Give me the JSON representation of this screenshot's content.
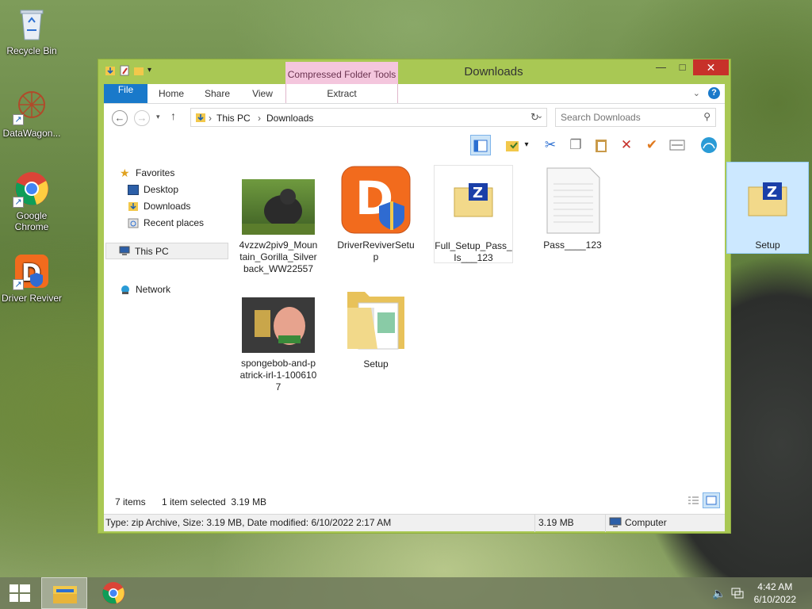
{
  "desktop": {
    "icons": [
      {
        "label": "Recycle Bin"
      },
      {
        "label": "DataWagon..."
      },
      {
        "label": "Google Chrome"
      },
      {
        "label": "Driver Reviver"
      }
    ]
  },
  "window": {
    "title": "Downloads",
    "context_tab_group": "Compressed Folder Tools",
    "ribbon_tabs": [
      "File",
      "Home",
      "Share",
      "View",
      "Extract"
    ],
    "address": {
      "crumbs": [
        "This PC",
        "Downloads"
      ]
    },
    "search": {
      "placeholder": "Search Downloads"
    },
    "nav": {
      "favorites": "Favorites",
      "desktop": "Desktop",
      "downloads": "Downloads",
      "recent": "Recent places",
      "this_pc": "This PC",
      "network": "Network"
    },
    "files": [
      {
        "name": "4vzzw2piv9_Mountain_Gorilla_Silverback_WW22557",
        "type": "image"
      },
      {
        "name": "DriverReviverSetup",
        "type": "app"
      },
      {
        "name": "Full_Setup_Pass_Is___123",
        "type": "zip"
      },
      {
        "name": "Pass____123",
        "type": "text"
      },
      {
        "name": "Setup",
        "type": "zip",
        "selected": true
      },
      {
        "name": "spongebob-and-patrick-irl-1-1006107",
        "type": "image"
      },
      {
        "name": "Setup",
        "type": "folder"
      }
    ],
    "status": {
      "items_count": "7 items",
      "selected": "1 item selected  3.19 MB",
      "details": "Type: zip Archive, Size: 3.19 MB, Date modified: 6/10/2022 2:17 AM",
      "size": "3.19 MB",
      "location": "Computer"
    }
  },
  "taskbar": {
    "time": "4:42 AM",
    "date": "6/10/2022"
  }
}
